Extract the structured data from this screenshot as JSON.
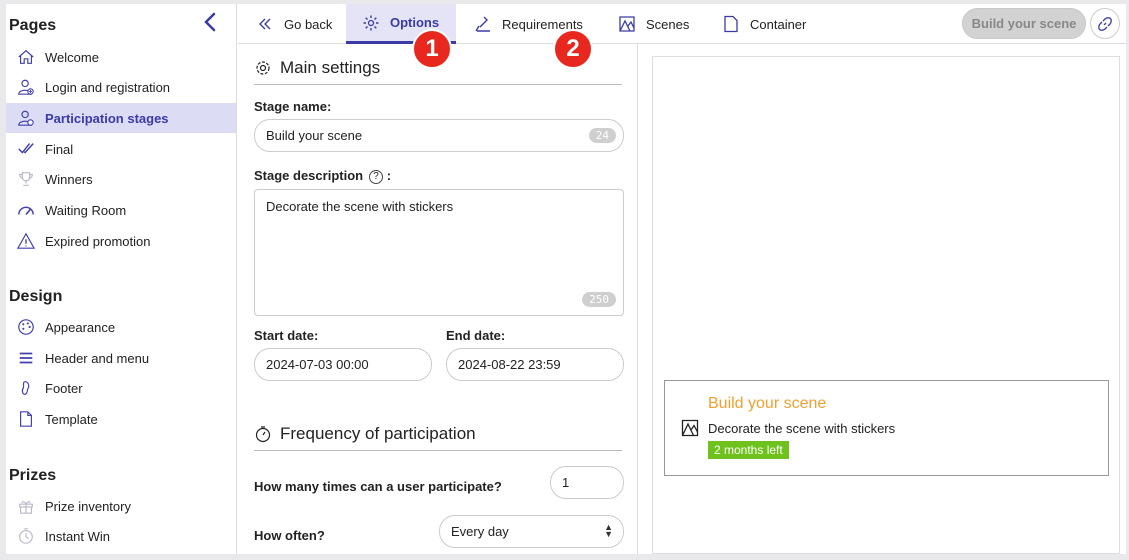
{
  "sidebar": {
    "sections": [
      {
        "title": "Pages",
        "items": [
          {
            "label": "Welcome",
            "icon": "home-icon"
          },
          {
            "label": "Login and registration",
            "icon": "user-add-icon"
          },
          {
            "label": "Participation stages",
            "icon": "user-stages-icon",
            "active": true
          },
          {
            "label": "Final",
            "icon": "double-check-icon"
          },
          {
            "label": "Winners",
            "icon": "trophy-icon"
          },
          {
            "label": "Waiting Room",
            "icon": "gauge-icon"
          },
          {
            "label": "Expired promotion",
            "icon": "warning-icon"
          }
        ]
      },
      {
        "title": "Design",
        "items": [
          {
            "label": "Appearance",
            "icon": "palette-icon"
          },
          {
            "label": "Header and menu",
            "icon": "menu-icon"
          },
          {
            "label": "Footer",
            "icon": "footer-icon"
          },
          {
            "label": "Template",
            "icon": "document-icon"
          }
        ]
      },
      {
        "title": "Prizes",
        "items": [
          {
            "label": "Prize inventory",
            "icon": "gift-icon"
          },
          {
            "label": "Instant Win",
            "icon": "instant-win-icon"
          }
        ]
      }
    ]
  },
  "topnav": {
    "tabs": [
      {
        "label": "Go back",
        "icon": "double-chevron-left-icon"
      },
      {
        "label": "Options",
        "icon": "gear-icon",
        "active": true
      },
      {
        "label": "Requirements",
        "icon": "stamp-icon"
      },
      {
        "label": "Scenes",
        "icon": "scene-icon"
      },
      {
        "label": "Container",
        "icon": "document-icon"
      }
    ],
    "badges": [
      "1",
      "2"
    ],
    "build_button": "Build your scene",
    "link_icon": "link-icon"
  },
  "main_settings": {
    "title": "Main settings",
    "stage_name_label": "Stage name:",
    "stage_name_value": "Build your scene",
    "stage_name_count": "24",
    "description_label": "Stage description",
    "description_suffix": ":",
    "description_help": "?",
    "description_value": "Decorate the scene with stickers",
    "description_count": "250",
    "start_label": "Start date:",
    "start_value": "2024-07-03 00:00",
    "end_label": "End date:",
    "end_value": "2024-08-22 23:59"
  },
  "frequency": {
    "title": "Frequency of participation",
    "times_label": "How many times can a user participate?",
    "times_value": "1",
    "often_label": "How often?",
    "often_value": "Every day"
  },
  "preview": {
    "card_title": "Build your scene",
    "card_desc": "Decorate the scene with stickers",
    "card_badge": "2 months left"
  },
  "colors": {
    "accent": "#3b3ba8",
    "badge_red": "#e8281e",
    "card_title": "#f0a030",
    "time_badge": "#6fc21d"
  }
}
